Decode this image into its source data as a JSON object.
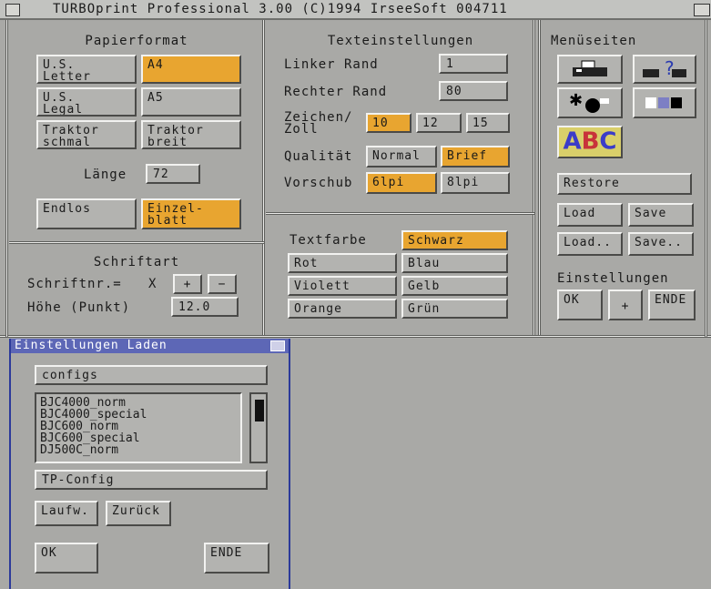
{
  "title": "TURBOprint Professional 3.00 (C)1994 IrseeSoft  004711",
  "papierformat": {
    "heading": "Papierformat",
    "us_letter": "U.S.\nLetter",
    "a4": "A4",
    "us_legal": "U.S.\nLegal",
    "a5": "A5",
    "traktor_schmal": "Traktor\nschmal",
    "traktor_breit": "Traktor\nbreit",
    "laenge_label": "Länge",
    "laenge_value": "72",
    "endlos": "Endlos",
    "einzelblatt": "Einzel-\nblatt"
  },
  "schriftart": {
    "heading": "Schriftart",
    "schriftnr_label": "Schriftnr.=",
    "schriftnr_value": "X",
    "plus": "+",
    "minus": "−",
    "hoehe_label": "Höhe (Punkt)",
    "hoehe_value": "12.0"
  },
  "texteinstellungen": {
    "heading": "Texteinstellungen",
    "linker_rand_label": "Linker Rand",
    "linker_rand_value": "1",
    "rechter_rand_label": "Rechter Rand",
    "rechter_rand_value": "80",
    "zeichen_label": "Zeichen/\nZoll",
    "cpi_10": "10",
    "cpi_12": "12",
    "cpi_15": "15",
    "qualitaet_label": "Qualität",
    "normal": "Normal",
    "brief": "Brief",
    "vorschub_label": "Vorschub",
    "lpi_6": "6lpi",
    "lpi_8": "8lpi"
  },
  "textfarbe": {
    "label": "Textfarbe",
    "schwarz": "Schwarz",
    "rot": "Rot",
    "blau": "Blau",
    "violett": "Violett",
    "gelb": "Gelb",
    "orange": "Orange",
    "gruen": "Grün"
  },
  "menueseiten": {
    "heading": "Menüseiten",
    "abc": "ABC",
    "restore": "Restore",
    "load": "Load",
    "save": "Save",
    "load_as": "Load..",
    "save_as": "Save..",
    "einstellungen": "Einstellungen",
    "ok": "OK",
    "plus": "+",
    "ende": "ENDE"
  },
  "laden_window": {
    "title": "Einstellungen Laden",
    "drawer": "configs",
    "files": [
      "BJC4000_norm",
      "BJC4000_special",
      "BJC600_norm",
      "BJC600_special",
      "DJ500C_norm"
    ],
    "file": "TP-Config",
    "laufw": "Laufw.",
    "zurueck": "Zurück",
    "ok": "OK",
    "ende": "ENDE"
  },
  "colors": {
    "selected": "#e8a530",
    "background": "#a9a9a6",
    "window_title": "#5d67b6"
  }
}
